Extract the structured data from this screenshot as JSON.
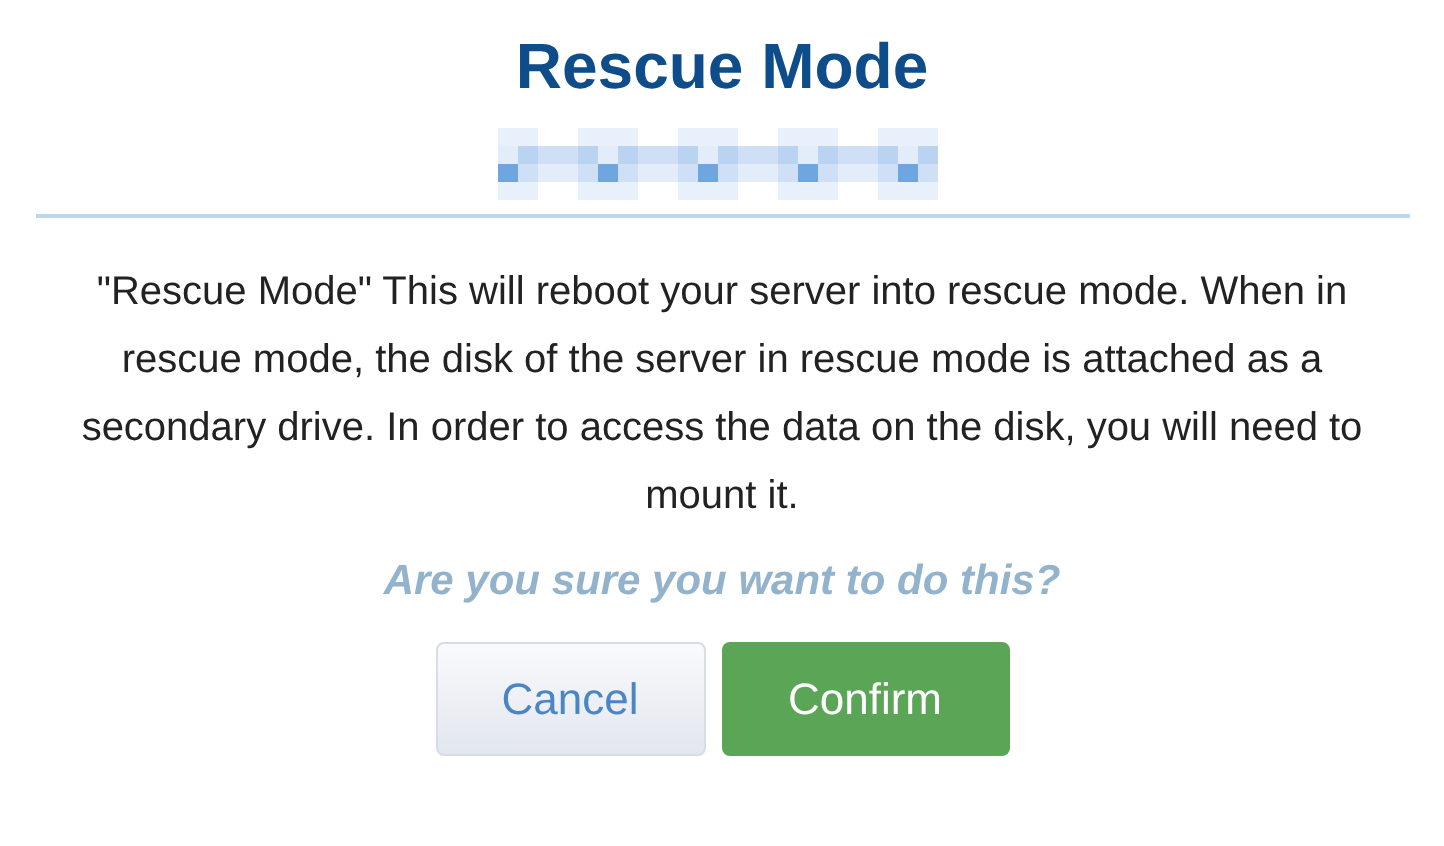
{
  "dialog": {
    "title": "Rescue Mode",
    "subtitle": {
      "kind": "redacted"
    },
    "message": "\"Rescue Mode\" This will reboot your server into rescue mode. When in rescue mode, the disk of the server in rescue mode is attached as a secondary drive. In order to access the data on the disk, you will need to mount it.",
    "question": "Are you sure you want to do this?",
    "buttons": [
      {
        "label": "Cancel",
        "kind": "secondary"
      },
      {
        "label": "Confirm",
        "kind": "primary"
      }
    ]
  }
}
